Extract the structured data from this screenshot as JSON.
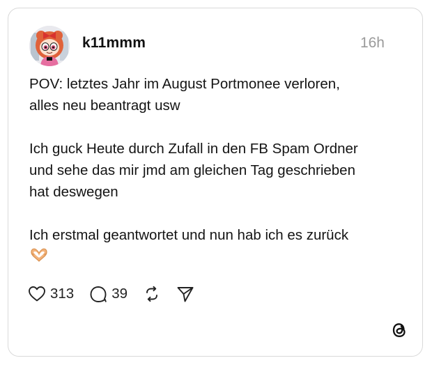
{
  "post": {
    "username": "k11mmm",
    "timestamp": "16h",
    "lines": [
      "POV: letztes Jahr im August Portmonee verloren,",
      "alles neu beantragt usw",
      "",
      "Ich guck Heute durch Zufall in den FB Spam Ordner",
      "und sehe das mir jmd am gleichen Tag geschrieben",
      "hat deswegen",
      "",
      "Ich erstmal geantwortet und nun hab ich es zurück"
    ],
    "emoji_icon": "heart-hands-emoji"
  },
  "actions": {
    "likes": "313",
    "replies": "39",
    "like_icon": "heart-icon",
    "reply_icon": "speech-bubble-icon",
    "repost_icon": "repost-icon",
    "share_icon": "paper-plane-icon"
  },
  "brand": {
    "logo": "threads-logo-icon"
  },
  "colors": {
    "border": "#d9d9d9",
    "text": "#101010",
    "muted": "#9a9a9a",
    "emoji": "#f2b27a"
  }
}
